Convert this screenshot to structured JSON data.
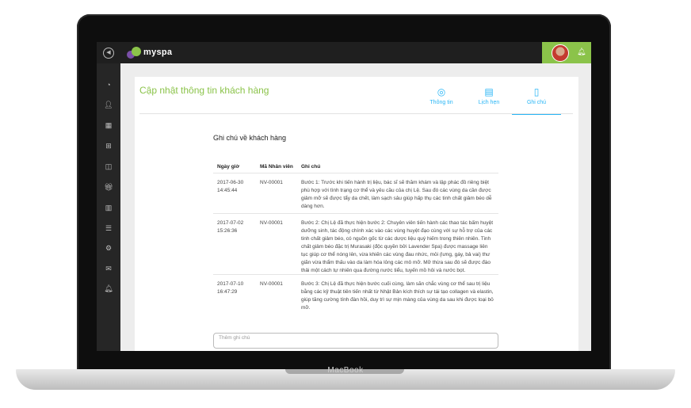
{
  "laptop": {
    "brand": "MacBook"
  },
  "topbar": {
    "menu_icon": "menu-toggle-icon",
    "logo_text": "myspa",
    "colors": {
      "topbar_bg": "#1f1f1f",
      "accent": "#8bc34a",
      "sidebar_bg": "#262626"
    },
    "bell_icon": "bell-icon"
  },
  "sidebar": {
    "items": [
      {
        "icon": "dashboard-icon"
      },
      {
        "icon": "customers-icon"
      },
      {
        "icon": "calendar-icon"
      },
      {
        "icon": "grid-icon"
      },
      {
        "icon": "bag-icon"
      },
      {
        "icon": "gift-icon"
      },
      {
        "icon": "bar-chart-icon"
      },
      {
        "icon": "list-icon"
      },
      {
        "icon": "settings-icon"
      },
      {
        "icon": "mail-icon"
      },
      {
        "icon": "notification-icon"
      }
    ]
  },
  "page": {
    "title": "Cập nhật thông tin khách hàng",
    "tabs": [
      {
        "label": "Thông tin",
        "icon": "user-icon"
      },
      {
        "label": "Lịch hẹn",
        "icon": "document-icon"
      },
      {
        "label": "Ghi chú",
        "icon": "notebook-icon"
      }
    ],
    "active_tab": "Ghi chú"
  },
  "notes": {
    "title": "Ghi chú về khách hàng",
    "columns": [
      "Ngày giờ",
      "Mã Nhân viên",
      "Ghi chú"
    ],
    "rows": [
      {
        "datetime": "2017-06-30 14:45:44",
        "employee": "NV-00001",
        "note": "Bước 1: Trước khi tiến hành trị liệu, bác sĩ sẽ thăm khám và lập phác đồ riêng biệt phù hợp với tình trạng cơ thể và yêu cầu của chị Lệ. Sau đó các vùng da cần được giảm mỡ sẽ được tẩy da chết, làm sạch sâu giúp hấp thụ các tinh chất giảm béo dễ dàng hơn."
      },
      {
        "datetime": "2017-07-02 15:26:36",
        "employee": "NV-00001",
        "note": "Bước 2: Chị Lệ đã thực hiện bước 2: Chuyên viên tiến hành các thao tác bấm huyệt dưỡng sinh, tác động chính xác vào các vùng huyệt đạo cùng với sự hỗ trợ của các tinh chất giảm béo, có nguồn gốc từ các dược liệu quý hiếm trong thiên nhiên. Tinh chất giảm béo đặc trị Murasaki (độc quyền bởi Lavender Spa) được massage liên tục giúp cơ thể nóng lên, vừa khiến các vùng đau nhức, mỏi (lưng, gáy, bả vai) thư giãn vừa thẩm thấu vào da làm hóa lỏng các mô mỡ. Mỡ thừa sau đó sẽ được đào thải một cách tự nhiên qua đường nước tiểu, tuyến mồ hôi và nước bọt."
      },
      {
        "datetime": "2017-07-10 16:47:29",
        "employee": "NV-00001",
        "note": "Bước 3: Chị Lệ đã thực hiện bước cuối cùng, làm săn chắc vùng cơ thể sau trị liệu bằng các kỹ thuật tiên tiến nhất từ Nhật Bản kích thích sự tái tạo collagen và elastin, giúp tăng cường tính đàn hồi, duy trì sự mịn màng của vùng da sau khi được loại bỏ mỡ."
      }
    ],
    "input_placeholder": "Thêm ghi chú"
  }
}
